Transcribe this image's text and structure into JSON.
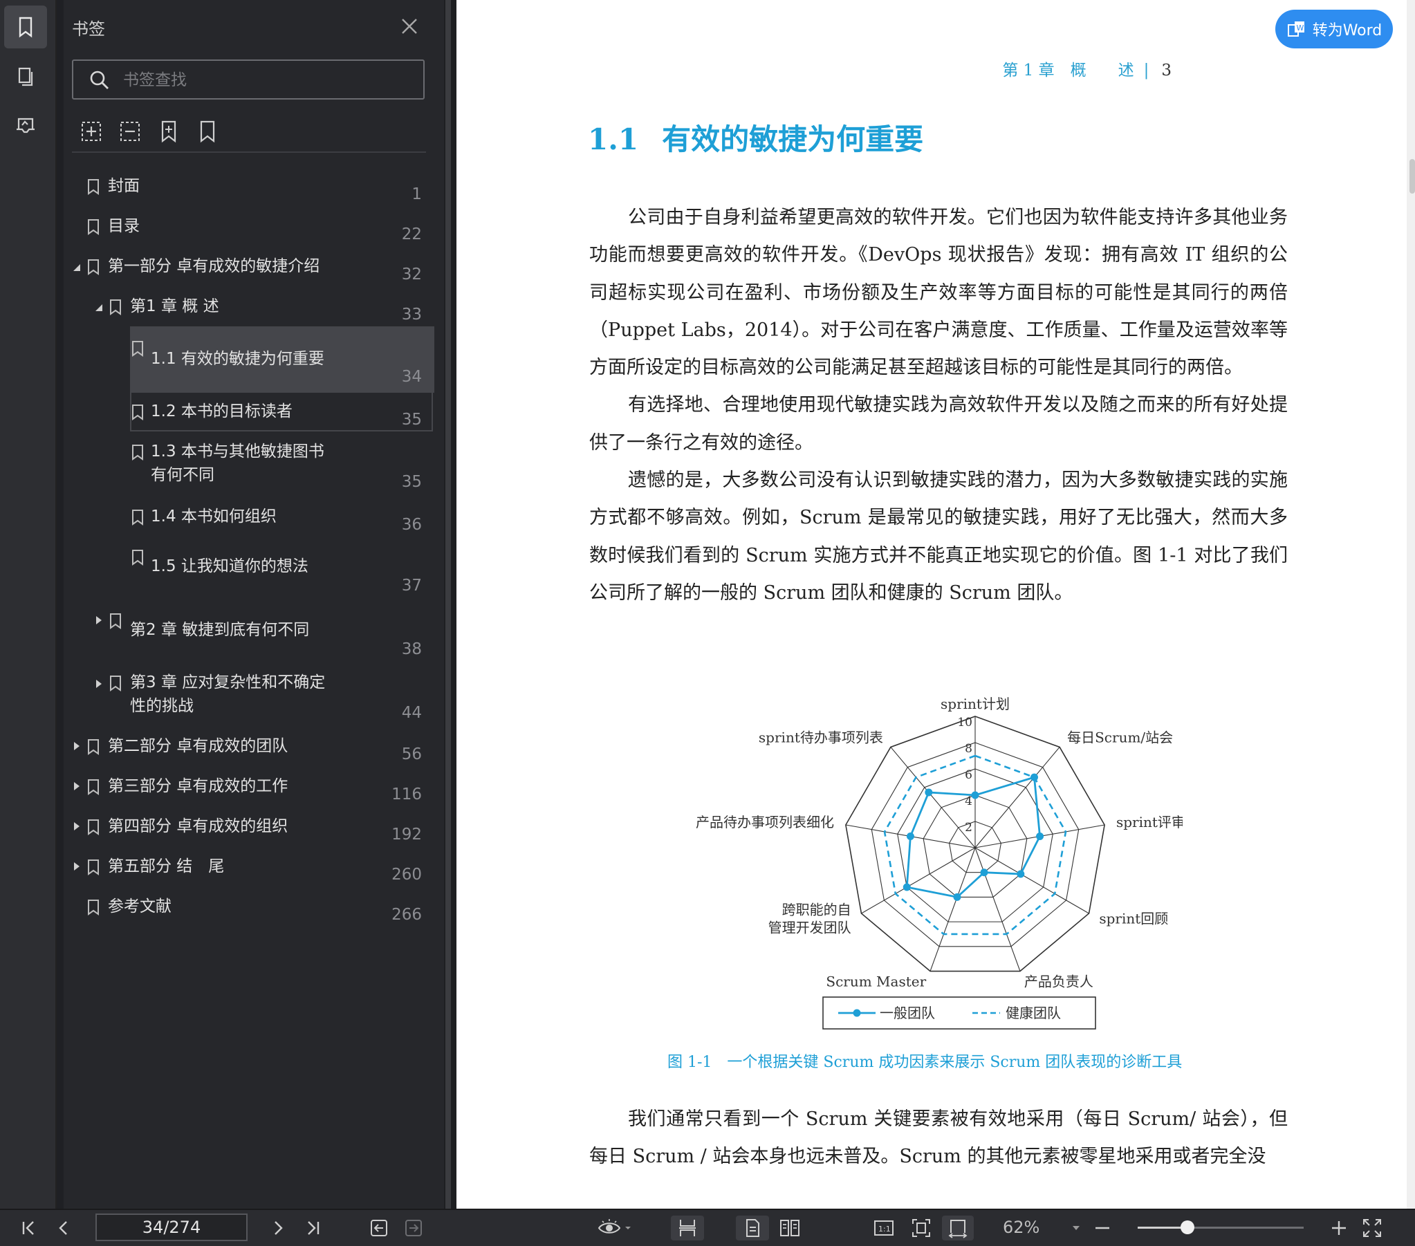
{
  "sidebar_panel": {
    "title": "书签",
    "search_placeholder": "书签查找",
    "bookmarks": [
      {
        "label": "封面",
        "page": "1"
      },
      {
        "label": "目录",
        "page": "22"
      },
      {
        "label": "第一部分 卓有成效的敏捷介绍",
        "page": "32"
      },
      {
        "label": "第1 章 概 述",
        "page": "33"
      },
      {
        "label": "1.1 有效的敏捷为何重要",
        "page": "34"
      },
      {
        "label": "1.2 本书的目标读者",
        "page": "35"
      },
      {
        "label": "1.3 本书与其他敏捷图书",
        "label2": "有何不同",
        "page": "35"
      },
      {
        "label": "1.4 本书如何组织",
        "page": "36"
      },
      {
        "label": "1.5 让我知道你的想法",
        "page": "37"
      },
      {
        "label": "第2 章 敏捷到底有何不同",
        "page": "38"
      },
      {
        "label": "第3 章 应对复杂性和不确定",
        "label2": "性的挑战",
        "page": "44"
      },
      {
        "label": "第二部分 卓有成效的团队",
        "page": "56"
      },
      {
        "label": "第三部分 卓有成效的工作",
        "page": "116"
      },
      {
        "label": "第四部分 卓有成效的组织",
        "page": "192"
      },
      {
        "label": "第五部分 结　尾",
        "page": "260"
      },
      {
        "label": "参考文献",
        "page": "266"
      }
    ]
  },
  "document": {
    "convert_button": "转为Word",
    "running_head": {
      "chapter": "第 1 章　概　　述",
      "separator": "|",
      "page": "3"
    },
    "heading": {
      "number": "1.1",
      "title": "有效的敏捷为何重要"
    },
    "paragraphs": [
      "公司由于自身利益希望更高效的软件开发。它们也因为软件能支持许多其他业务功能而想要更高效的软件开发。《DevOps 现状报告》发现：拥有高效 IT 组织的公司超标实现公司在盈利、市场份额及生产效率等方面目标的可能性是其同行的两倍（Puppet Labs，2014）。对于公司在客户满意度、工作质量、工作量及运营效率等方面所设定的目标高效的公司能满足甚至超越该目标的可能性是其同行的两倍。",
      "有选择地、合理地使用现代敏捷实践为高效软件开发以及随之而来的所有好处提供了一条行之有效的途径。",
      "遗憾的是，大多数公司没有认识到敏捷实践的潜力，因为大多数敏捷实践的实施方式都不够高效。例如，Scrum 是最常见的敏捷实践，用好了无比强大，然而大多数时候我们看到的 Scrum 实施方式并不能真正地实现它的价值。图 1-1 对比了我们公司所了解的一般的 Scrum 团队和健康的 Scrum 团队。"
    ],
    "caption": "图 1-1　一个根据关键 Scrum 成功因素来展示 Scrum 团队表现的诊断工具",
    "after_paragraph": "我们通常只看到一个 Scrum 关键要素被有效地采用（每日 Scrum/ 站会），但每日 Scrum / 站会本身也远未普及。Scrum 的其他元素被零星地采用或者完全没"
  },
  "chart_data": {
    "type": "radar",
    "categories": [
      "sprint计划",
      "每日Scrum/站会",
      "sprint评审",
      "sprint回顾",
      "产品负责人",
      "Scrum Master",
      "跨职能的自管理开发团队",
      "产品待办事项列表细化",
      "sprint待办事项列表"
    ],
    "category_label_lines": [
      [
        "sprint计划"
      ],
      [
        "每日Scrum/站会"
      ],
      [
        "sprint评审"
      ],
      [
        "sprint回顾"
      ],
      [
        "产品负责人"
      ],
      [
        "Scrum Master"
      ],
      [
        "跨职能的自",
        "管理开发团队"
      ],
      [
        "产品待办事项列表细化"
      ],
      [
        "sprint待办事项列表"
      ]
    ],
    "rmax": 10,
    "tick_labels": [
      "2",
      "4",
      "6",
      "8",
      "10"
    ],
    "series": [
      {
        "name": "一般团队",
        "values": [
          4,
          7,
          5,
          4,
          2,
          4,
          6,
          5,
          5.5
        ],
        "style": "solid-marker"
      },
      {
        "name": "健康团队",
        "values": [
          7,
          7,
          7,
          7,
          7,
          7,
          7,
          7,
          7
        ],
        "style": "dashed"
      }
    ],
    "color": "#1e9fd6"
  },
  "bottom_bar": {
    "page_indicator": "34/274",
    "zoom": "62%",
    "zoom_fraction": 0.3
  }
}
